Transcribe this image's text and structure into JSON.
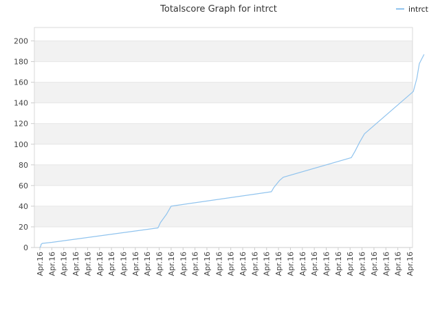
{
  "chart_data": {
    "type": "line",
    "title": "Totalscore Graph for intrct",
    "xlabel": "",
    "ylabel": "",
    "ylim": [
      0,
      213
    ],
    "yticks": [
      0,
      20,
      40,
      60,
      80,
      100,
      120,
      140,
      160,
      180,
      200
    ],
    "x_tick_labels": [
      "Apr.16",
      "Apr.16",
      "Apr.16",
      "Apr.16",
      "Apr.16",
      "Apr.16",
      "Apr.16",
      "Apr.16",
      "Apr.16",
      "Apr.16",
      "Apr.16",
      "Apr.16",
      "Apr.16",
      "Apr.16",
      "Apr.16",
      "Apr.16",
      "Apr.16",
      "Apr.16",
      "Apr.16",
      "Apr.16",
      "Apr.16",
      "Apr.16",
      "Apr.16",
      "Apr.16",
      "Apr.16",
      "Apr.16",
      "Apr.16",
      "Apr.16",
      "Apr.16",
      "Apr.16",
      "Apr.16",
      "Apr.16"
    ],
    "grid": true,
    "legend_position": "top-right",
    "colors": {
      "line": "#8fc3ee",
      "band": "#f2f2f2",
      "plot_bg": "#ffffff",
      "axis": "#cccccc"
    },
    "series": [
      {
        "name": "intrct",
        "x": [
          0,
          0.06,
          0.09,
          0.1,
          0.2,
          1.0,
          9.9,
          10.1,
          10.6,
          11.0,
          19.4,
          19.6,
          20.1,
          20.4,
          26.1,
          26.4,
          26.8,
          27.2,
          31.3,
          31.6,
          31.8,
          32.2
        ],
        "y": [
          0,
          1,
          2,
          3,
          4,
          5,
          19,
          24,
          32,
          40,
          54,
          58,
          65,
          68,
          87,
          93,
          102,
          110,
          151,
          164,
          178,
          187
        ]
      }
    ]
  }
}
